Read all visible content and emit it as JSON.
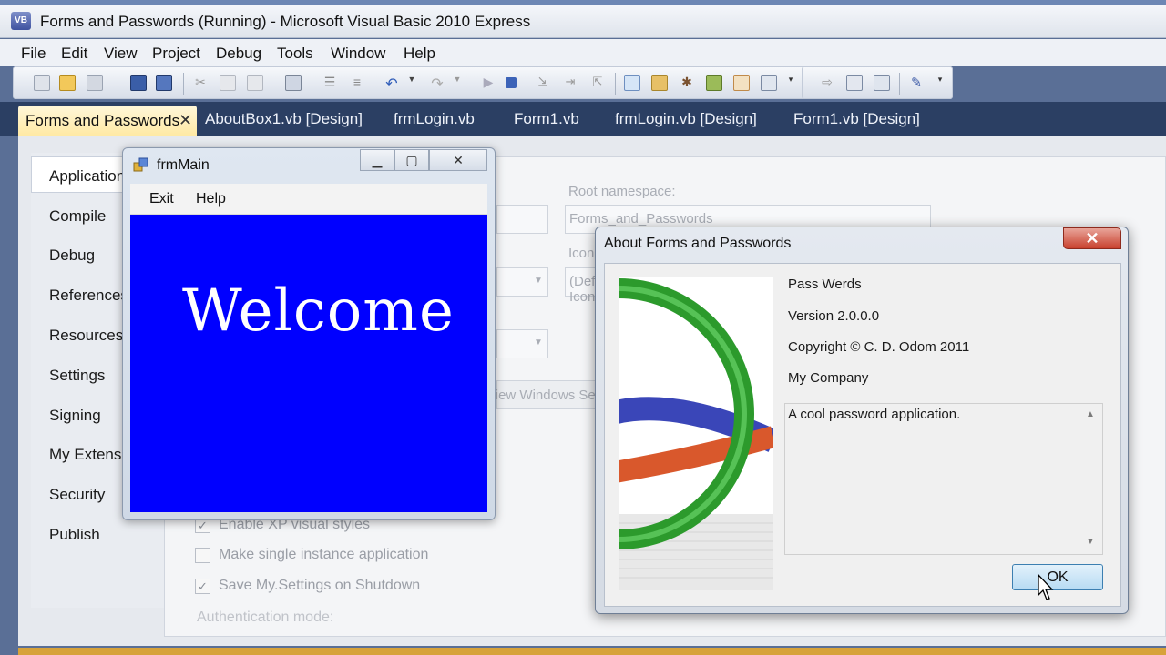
{
  "ide": {
    "title": "Forms and Passwords (Running) - Microsoft Visual Basic 2010 Express",
    "menu": [
      "File",
      "Edit",
      "View",
      "Project",
      "Debug",
      "Tools",
      "Window",
      "Help"
    ],
    "tabs": [
      "Forms and Passwords",
      "AboutBox1.vb [Design]",
      "frmLogin.vb",
      "Form1.vb",
      "frmLogin.vb [Design]",
      "Form1.vb [Design]"
    ],
    "active_tab": "Forms and Passwords",
    "side_items": [
      "Application",
      "Compile",
      "Debug",
      "References",
      "Resources",
      "Settings",
      "Signing",
      "My Extensions",
      "Security",
      "Publish"
    ],
    "root_namespace_label": "Root namespace:",
    "root_namespace_value": "Forms_and_Passwords",
    "icon_label": "Icon:",
    "icon_value": "(Default Icon)",
    "windows_settings_button": "View Windows Settings",
    "checkboxes": [
      {
        "label": "Enable XP visual styles",
        "checked": true
      },
      {
        "label": "Make single instance application",
        "checked": false
      },
      {
        "label": "Save My.Settings on Shutdown",
        "checked": true
      },
      {
        "label": "Authentication mode:",
        "checked": null
      }
    ]
  },
  "frm_main": {
    "title": "frmMain",
    "menu": [
      "Exit",
      "Help"
    ],
    "welcome": "Welcome",
    "client_color": "#0000ff"
  },
  "about": {
    "title": "About Forms and Passwords",
    "product": "Pass Werds",
    "version": "Version 2.0.0.0",
    "copyright": "Copyright © C. D. Odom 2011",
    "company": "My Company",
    "description": "A cool password application.",
    "ok_label": "OK"
  }
}
